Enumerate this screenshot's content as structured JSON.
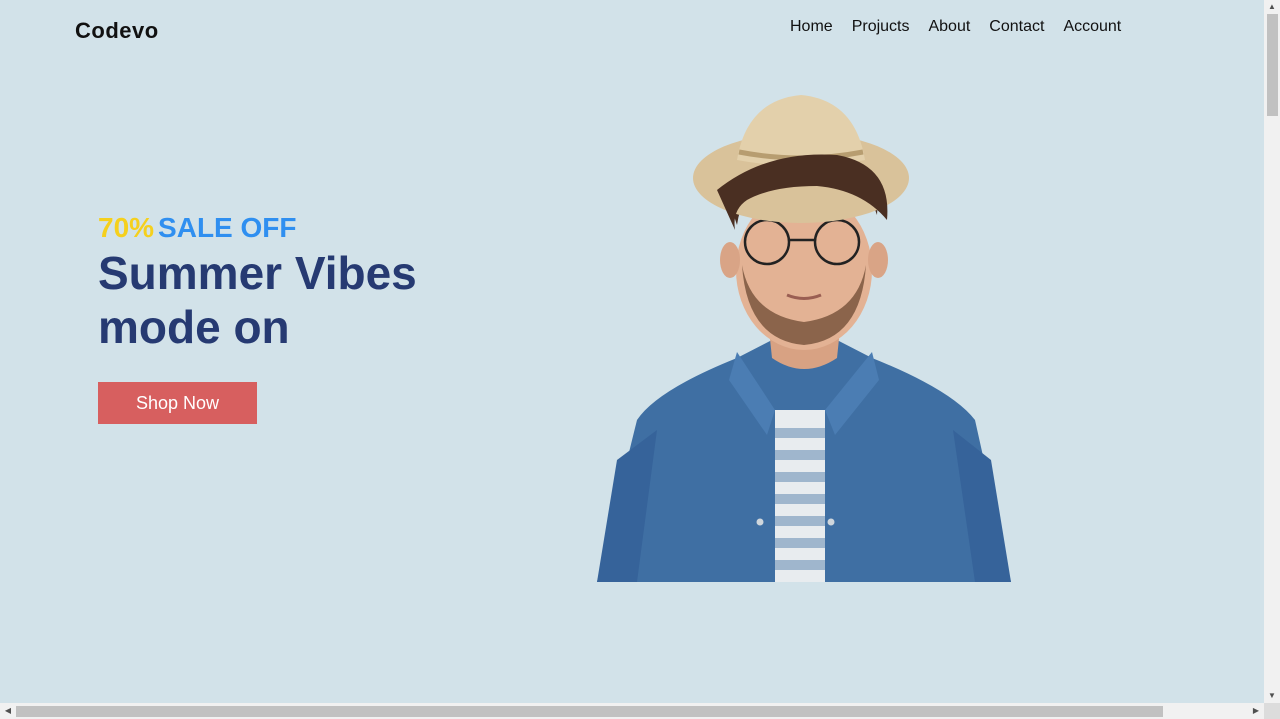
{
  "header": {
    "logo": "Codevo",
    "nav": [
      "Home",
      "Projucts",
      "About",
      "Contact",
      "Account"
    ]
  },
  "hero": {
    "sale_percent": "70%",
    "sale_text": "SALE OFF",
    "headline": "Summer Vibes mode on",
    "button_label": "Shop Now",
    "image": "man-in-straw-hat-denim-shirt"
  },
  "colors": {
    "background": "#d2e2e9",
    "sale_percent": "#f5d01d",
    "sale_text": "#2f8ff0",
    "headline": "#263a72",
    "button": "#d75f5f"
  }
}
